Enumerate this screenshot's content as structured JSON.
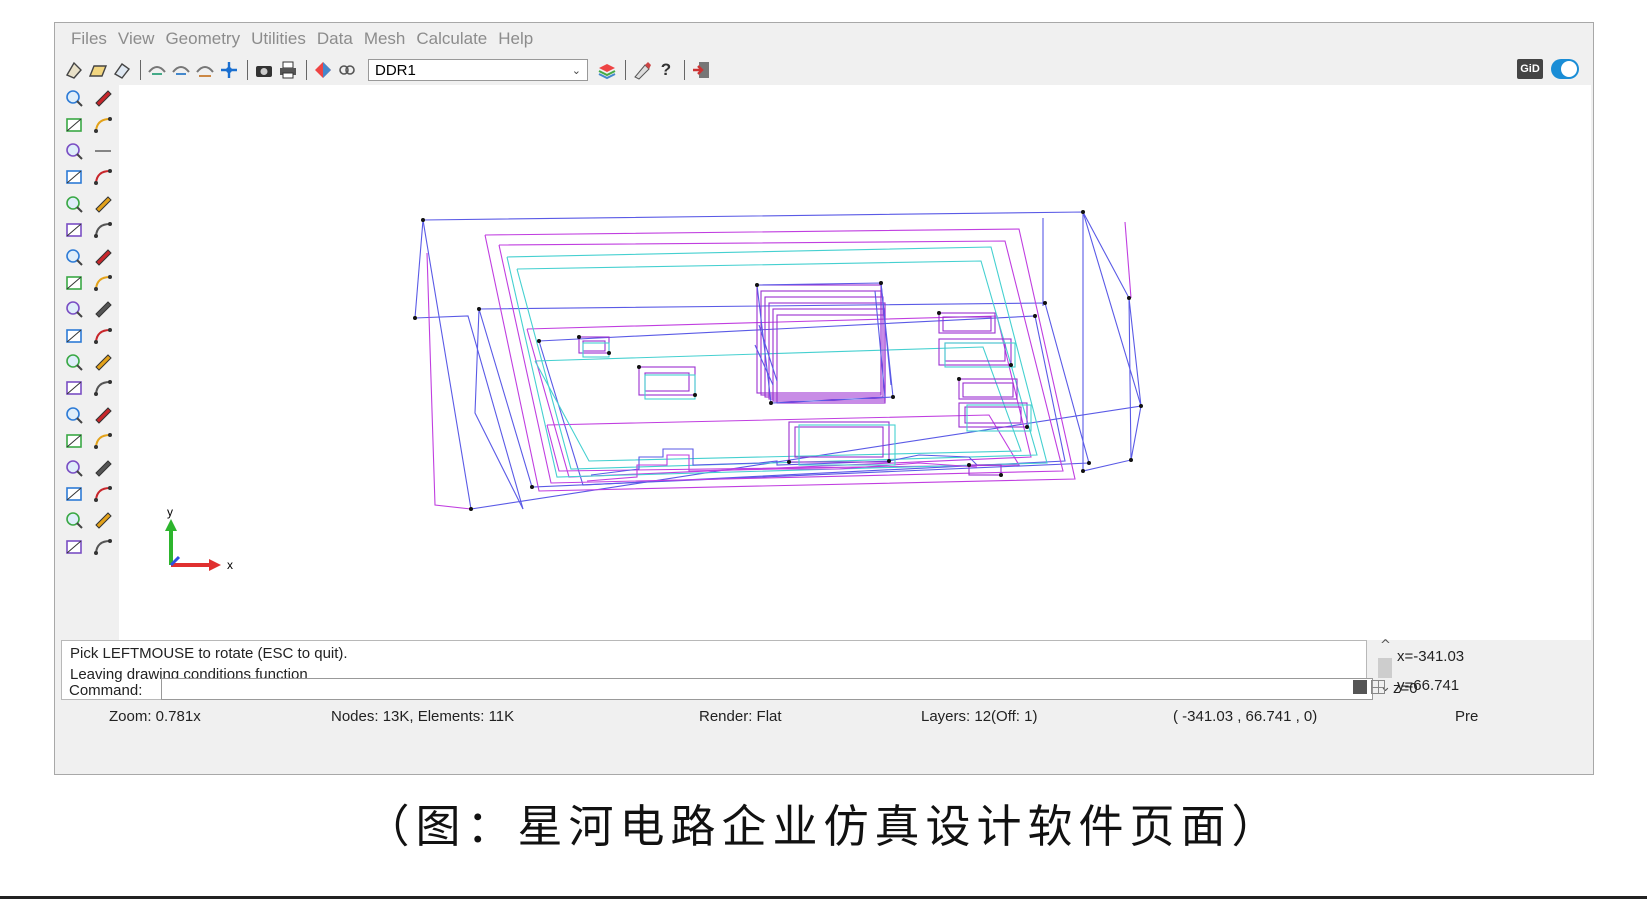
{
  "menu": [
    "Files",
    "View",
    "Geometry",
    "Utilities",
    "Data",
    "Mesh",
    "Calculate",
    "Help"
  ],
  "toolbar": {
    "layer_select": "DDR1",
    "icons": [
      "new-icon",
      "open-icon",
      "save-icon",
      "zoom-in-icon",
      "zoom-out-icon",
      "zoom-frame-icon",
      "pan-icon",
      "screenshot-icon",
      "print-icon",
      "render-icon",
      "view-icon",
      "layers-icon",
      "tools-icon",
      "help-icon",
      "exit-icon"
    ],
    "logo": "GiD"
  },
  "left_toolbar_icons": [
    "zoom-icon",
    "point-icon",
    "zoom-out-icon",
    "edit-icon",
    "zoom-all-icon",
    "line-sep-icon",
    "redraw-icon",
    "surface-icon",
    "color-icon",
    "select-box-icon",
    "arrow-icon",
    "text-icon",
    "line-icon",
    "layers-icon",
    "arc-icon",
    "folder-icon",
    "spline-icon",
    "folder-icon",
    "polyline-icon",
    "surface-tool-icon",
    "nurbs-icon",
    "surface-tool-icon",
    "contact-icon",
    "mesh-icon",
    "volume-icon",
    "curve-icon",
    "shape-icon",
    "curve-icon",
    "pen-icon",
    "cross-icon",
    "edit-box-icon",
    "mesh-grid-icon",
    "delete-icon",
    "mesh-grid-icon",
    "view-rotate-icon",
    "mesh-grid-icon"
  ],
  "messages": {
    "line1": "Pick LEFTMOUSE to rotate (ESC to quit).",
    "line2": "Leaving drawing conditions function"
  },
  "coords": {
    "x": "x=-341.03",
    "y": "y=66.741",
    "z": "z=0"
  },
  "command": {
    "label": "Command:",
    "value": ""
  },
  "status": {
    "zoom": "Zoom: 0.781x",
    "nodes": "Nodes: 13K, Elements: 11K",
    "render": "Render: Flat",
    "layers": "Layers: 12(Off: 1)",
    "position": "( -341.03 , 66.741 , 0)",
    "mode": "Pre"
  },
  "axes": {
    "y_label": "y",
    "x_label": "x"
  },
  "colors": {
    "accent": "#1a8dd6",
    "wire_blue": "#5a5ae6",
    "wire_magenta": "#c03ee0",
    "wire_cyan": "#45d0d0"
  },
  "caption": "（图：星河电路企业仿真设计软件页面）"
}
